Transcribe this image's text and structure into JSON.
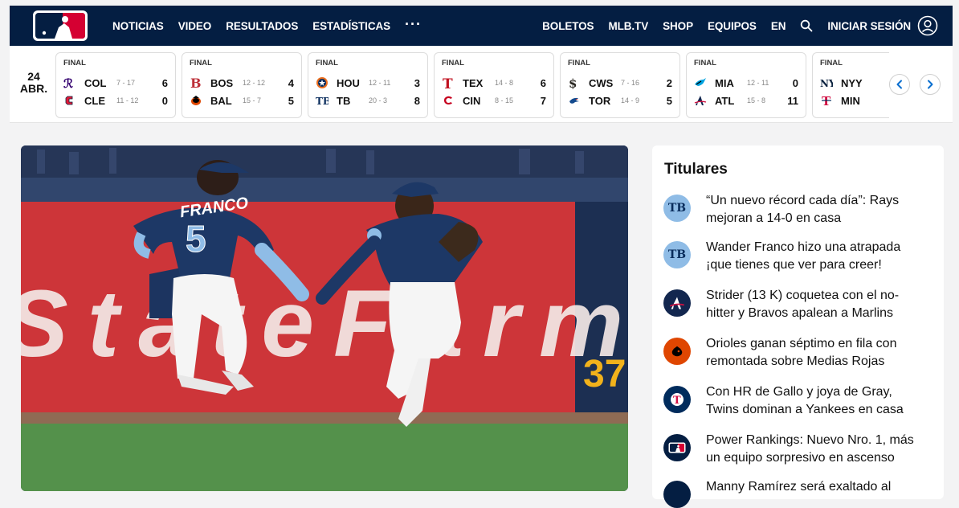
{
  "nav": {
    "left_items": [
      "NOTICIAS",
      "VIDEO",
      "RESULTADOS",
      "ESTADÍSTICAS"
    ],
    "more": "···",
    "right_items": [
      "BOLETOS",
      "MLB.TV",
      "SHOP",
      "EQUIPOS",
      "EN"
    ],
    "login": "INICIAR SESIÓN"
  },
  "scoreboard": {
    "date_day": "24",
    "date_month": "ABR.",
    "games": [
      {
        "status": "FINAL",
        "away": {
          "abbr": "COL",
          "record": "7 - 17",
          "score": "6"
        },
        "home": {
          "abbr": "CLE",
          "record": "11 - 12",
          "score": "0"
        }
      },
      {
        "status": "FINAL",
        "away": {
          "abbr": "BOS",
          "record": "12 - 12",
          "score": "4"
        },
        "home": {
          "abbr": "BAL",
          "record": "15 - 7",
          "score": "5"
        }
      },
      {
        "status": "FINAL",
        "away": {
          "abbr": "HOU",
          "record": "12 - 11",
          "score": "3"
        },
        "home": {
          "abbr": "TB",
          "record": "20 - 3",
          "score": "8"
        }
      },
      {
        "status": "FINAL",
        "away": {
          "abbr": "TEX",
          "record": "14 - 8",
          "score": "6"
        },
        "home": {
          "abbr": "CIN",
          "record": "8 - 15",
          "score": "7"
        }
      },
      {
        "status": "FINAL",
        "away": {
          "abbr": "CWS",
          "record": "7 - 16",
          "score": "2"
        },
        "home": {
          "abbr": "TOR",
          "record": "14 - 9",
          "score": "5"
        }
      },
      {
        "status": "FINAL",
        "away": {
          "abbr": "MIA",
          "record": "12 - 11",
          "score": "0"
        },
        "home": {
          "abbr": "ATL",
          "record": "15 - 8",
          "score": "11"
        }
      },
      {
        "status": "FINAL",
        "away": {
          "abbr": "NYY",
          "record": "",
          "score": ""
        },
        "home": {
          "abbr": "MIN",
          "record": "",
          "score": ""
        }
      }
    ]
  },
  "hero": {
    "jersey_name": "FRANCO",
    "jersey_number": "5",
    "sign_text": "StateFarm",
    "wall_number": "37"
  },
  "headlines": {
    "title": "Titulares",
    "items": [
      {
        "text": "“Un nuevo récord cada día”: Rays mejoran a 14-0 en casa",
        "logo": "rays-logo-icon"
      },
      {
        "text": "Wander Franco hizo una atrapada ¡que tienes que ver para creer!",
        "logo": "rays-logo-icon"
      },
      {
        "text": "Strider (13 K) coquetea con el no-hitter y Bravos apalean a Marlins",
        "logo": "braves-logo-icon"
      },
      {
        "text": "Orioles ganan séptimo en fila con remontada sobre Medias Rojas",
        "logo": "orioles-logo-icon"
      },
      {
        "text": "Con HR de Gallo y joya de Gray, Twins dominan a Yankees en casa",
        "logo": "twins-logo-icon"
      },
      {
        "text": "Power Rankings: Nuevo Nro. 1, más un equipo sorpresivo en ascenso",
        "logo": "mlb-logo-icon"
      },
      {
        "text": "Manny Ramírez será exaltado al",
        "logo": "mlb-logo-icon"
      }
    ]
  },
  "colors": {
    "nav_bg": "#041e42",
    "mlb_red": "#d50032",
    "rays_navy": "#092c5c",
    "rays_light": "#8fbce6"
  }
}
